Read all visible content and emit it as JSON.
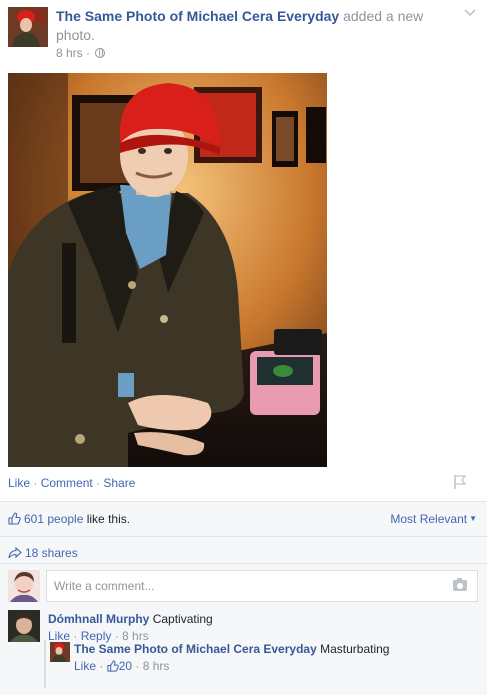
{
  "post": {
    "page_name": "The Same Photo of Michael Cera Everyday",
    "action_text": " added a new photo.",
    "timestamp": "8 hrs",
    "separator": " · "
  },
  "actions": {
    "like": "Like",
    "comment": "Comment",
    "share": "Share",
    "sep": " · "
  },
  "ufi": {
    "likes_count": "601 people",
    "likes_suffix": " like this.",
    "sort_label": "Most Relevant",
    "shares": "18 shares",
    "comment_placeholder": "Write a comment..."
  },
  "comments": [
    {
      "author": "Dómhnall Murphy",
      "text": "Captivating",
      "like": "Like",
      "reply": "Reply",
      "time": "8 hrs"
    }
  ],
  "reply": {
    "author": "The Same Photo of Michael Cera Everyday",
    "text": "Masturbating",
    "like": "Like",
    "likes_count": "20",
    "time": "8 hrs"
  },
  "colors": {
    "link": "#4267b2",
    "name": "#365899",
    "meta": "#90949c",
    "ufi_bg": "#f6f7f9",
    "hat_red": "#d81f1a"
  },
  "icons": [
    "globe-icon",
    "chevron-down-icon",
    "flag-icon",
    "thumbs-up-icon",
    "share-arrow-icon",
    "camera-icon"
  ]
}
